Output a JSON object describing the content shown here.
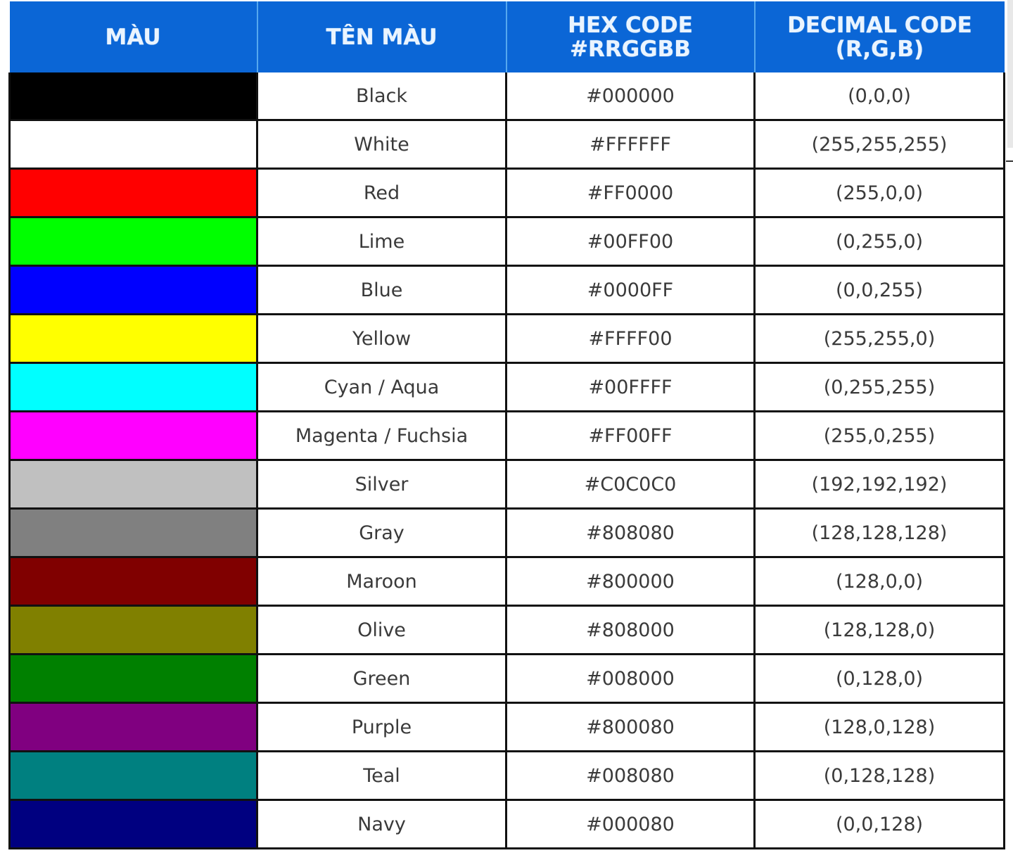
{
  "table": {
    "headers": {
      "swatch": "MÀU",
      "name": "TÊN MÀU",
      "hex_line1": "HEX CODE",
      "hex_line2": "#RRGGBB",
      "dec_line1": "DECIMAL CODE",
      "dec_line2": "(R,G,B)"
    },
    "header_color": "#0B66D6",
    "rows": [
      {
        "name": "Black",
        "hex": "#000000",
        "decimal": "(0,0,0)",
        "swatch": "#000000"
      },
      {
        "name": "White",
        "hex": "#FFFFFF",
        "decimal": "(255,255,255)",
        "swatch": "#FFFFFF"
      },
      {
        "name": "Red",
        "hex": "#FF0000",
        "decimal": "(255,0,0)",
        "swatch": "#FF0000"
      },
      {
        "name": "Lime",
        "hex": "#00FF00",
        "decimal": "(0,255,0)",
        "swatch": "#00FF00"
      },
      {
        "name": "Blue",
        "hex": "#0000FF",
        "decimal": "(0,0,255)",
        "swatch": "#0000FF"
      },
      {
        "name": "Yellow",
        "hex": "#FFFF00",
        "decimal": "(255,255,0)",
        "swatch": "#FFFF00"
      },
      {
        "name": "Cyan / Aqua",
        "hex": "#00FFFF",
        "decimal": "(0,255,255)",
        "swatch": "#00FFFF"
      },
      {
        "name": "Magenta / Fuchsia",
        "hex": "#FF00FF",
        "decimal": "(255,0,255)",
        "swatch": "#FF00FF"
      },
      {
        "name": "Silver",
        "hex": "#C0C0C0",
        "decimal": "(192,192,192)",
        "swatch": "#C0C0C0"
      },
      {
        "name": "Gray",
        "hex": "#808080",
        "decimal": "(128,128,128)",
        "swatch": "#808080"
      },
      {
        "name": "Maroon",
        "hex": "#800000",
        "decimal": "(128,0,0)",
        "swatch": "#800000"
      },
      {
        "name": "Olive",
        "hex": "#808000",
        "decimal": "(128,128,0)",
        "swatch": "#808000"
      },
      {
        "name": "Green",
        "hex": "#008000",
        "decimal": "(0,128,0)",
        "swatch": "#008000"
      },
      {
        "name": "Purple",
        "hex": "#800080",
        "decimal": "(128,0,128)",
        "swatch": "#800080"
      },
      {
        "name": "Teal",
        "hex": "#008080",
        "decimal": "(0,128,128)",
        "swatch": "#008080"
      },
      {
        "name": "Navy",
        "hex": "#000080",
        "decimal": "(0,0,128)",
        "swatch": "#000080"
      }
    ]
  }
}
